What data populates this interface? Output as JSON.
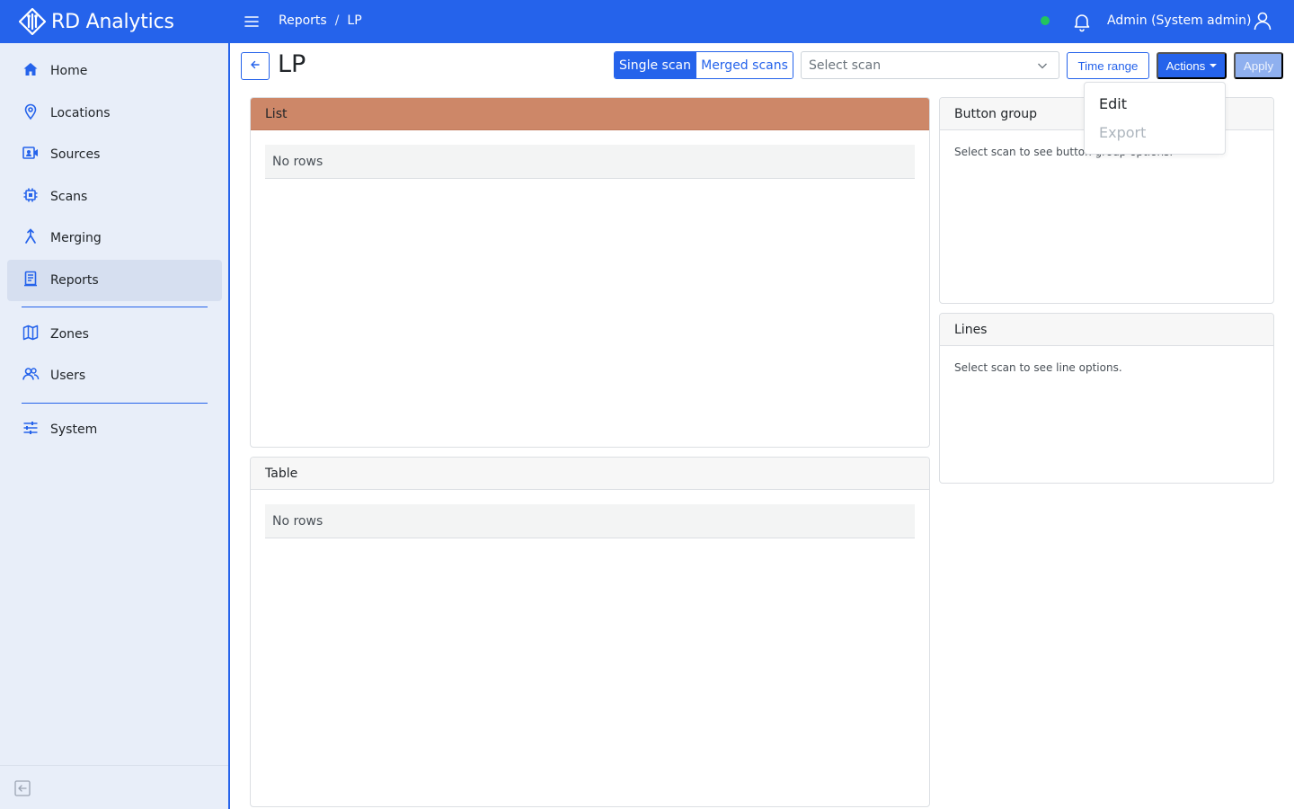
{
  "app": {
    "name": "RD Analytics"
  },
  "breadcrumb": {
    "parent": "Reports",
    "separator": "/",
    "current": "LP"
  },
  "user": {
    "name": "Admin (System admin)"
  },
  "colors": {
    "primary": "#2563eb",
    "sidebar_bg": "#e8eef9",
    "list_header": "#cd8768",
    "status_online": "#22c55e"
  },
  "sidebar": {
    "items": [
      {
        "label": "Home",
        "icon": "home-icon"
      },
      {
        "label": "Locations",
        "icon": "map-pin-icon"
      },
      {
        "label": "Sources",
        "icon": "camera-source-icon"
      },
      {
        "label": "Scans",
        "icon": "chip-icon"
      },
      {
        "label": "Merging",
        "icon": "merge-icon"
      },
      {
        "label": "Reports",
        "icon": "report-icon",
        "active": true
      },
      {
        "label": "Zones",
        "icon": "map-icon"
      },
      {
        "label": "Users",
        "icon": "users-icon"
      },
      {
        "label": "System",
        "icon": "sliders-icon"
      }
    ]
  },
  "header": {
    "title": "LP",
    "mode_tabs": [
      {
        "label": "Single scan",
        "selected": true
      },
      {
        "label": "Merged scans",
        "selected": false
      }
    ],
    "scan_select": {
      "placeholder": "Select scan"
    },
    "time_range_label": "Time range",
    "actions_label": "Actions",
    "apply_label": "Apply"
  },
  "actions_menu": {
    "items": [
      {
        "label": "Edit",
        "enabled": true
      },
      {
        "label": "Export",
        "enabled": false
      }
    ]
  },
  "cards": {
    "list": {
      "title": "List",
      "empty": "No rows"
    },
    "table": {
      "title": "Table",
      "empty": "No rows"
    },
    "button_group": {
      "title": "Button group",
      "note": "Select scan to see button group options."
    },
    "lines": {
      "title": "Lines",
      "note": "Select scan to see line options."
    }
  }
}
